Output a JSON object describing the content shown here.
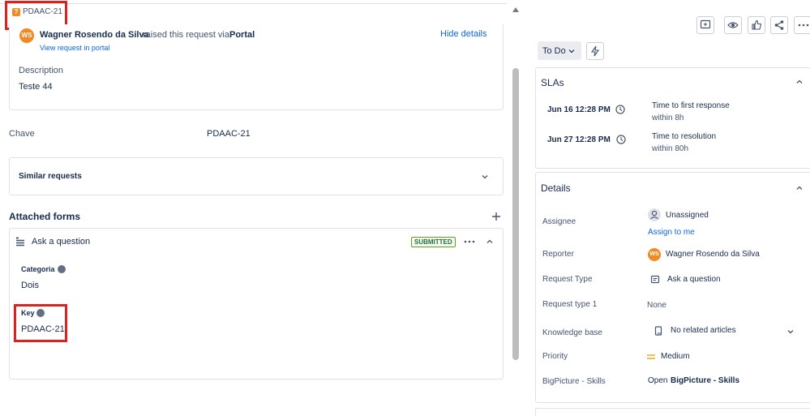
{
  "issue_key_header": "PDAAC-21",
  "request": {
    "reporter_initials": "WS",
    "reporter_name": "Wagner Rosendo da Silva",
    "raised_text": "raised this request via",
    "channel": "Portal",
    "view_portal": "View request in portal",
    "hide_details": "Hide details",
    "description_label": "Description",
    "description_value": "Teste 44"
  },
  "chave": {
    "label": "Chave",
    "value": "PDAAC-21"
  },
  "similar_requests": "Similar requests",
  "attached_forms": {
    "title": "Attached forms",
    "form_name": "Ask a question",
    "status": "SUBMITTED",
    "fields": [
      {
        "label": "Categoria",
        "value": "Dois"
      },
      {
        "label": "Key",
        "value": "PDAAC-21"
      }
    ]
  },
  "status_button": "To Do",
  "slas": {
    "title": "SLAs",
    "items": [
      {
        "time": "Jun 16 12:28 PM",
        "goal": "Time to first response",
        "within": "within 8h"
      },
      {
        "time": "Jun 27 12:28 PM",
        "goal": "Time to resolution",
        "within": "within 80h"
      }
    ]
  },
  "details": {
    "title": "Details",
    "assignee_label": "Assignee",
    "assignee_value": "Unassigned",
    "assign_to_me": "Assign to me",
    "reporter_label": "Reporter",
    "reporter_initials": "WS",
    "reporter_value": "Wagner Rosendo da Silva",
    "request_type_label": "Request Type",
    "request_type_value": "Ask a question",
    "request_type1_label": "Request type 1",
    "request_type1_value": "None",
    "kb_label": "Knowledge base",
    "kb_value": "No related articles",
    "priority_label": "Priority",
    "priority_value": "Medium",
    "priority_color": "#f5a623",
    "bigpicture_label": "BigPicture - Skills",
    "bigpicture_prefix": "Open",
    "bigpicture_value": "BigPicture - Skills"
  },
  "colors": {
    "accent": "#0c66e4",
    "highlight": "#e0201b",
    "brand_orange": "#f08a24"
  }
}
